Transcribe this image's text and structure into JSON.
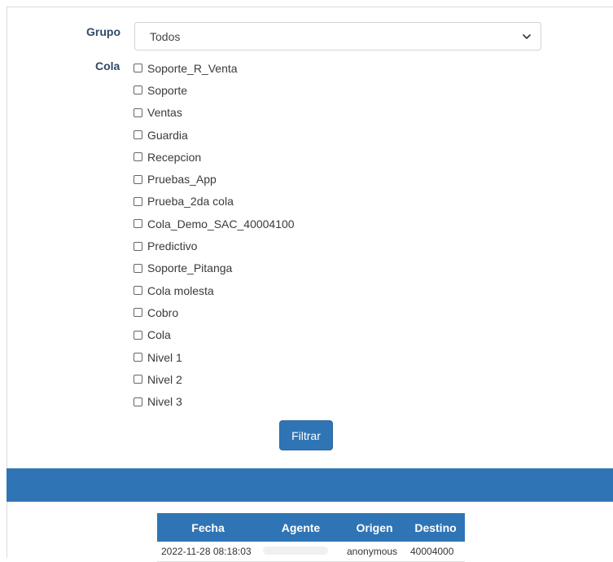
{
  "filters": {
    "grupo_label": "Grupo",
    "grupo_selected": "Todos",
    "cola_label": "Cola",
    "colas": [
      "Soporte_R_Venta",
      "Soporte",
      "Ventas",
      "Guardia",
      "Recepcion",
      "Pruebas_App",
      "Prueba_2da cola",
      "Cola_Demo_SAC_40004100",
      "Predictivo",
      "Soporte_Pitanga",
      "Cola molesta",
      "Cobro",
      "Cola",
      "Nivel 1",
      "Nivel 2",
      "Nivel 3"
    ],
    "filter_button": "Filtrar"
  },
  "table": {
    "headers": [
      "Fecha",
      "Agente",
      "Origen",
      "Destino"
    ],
    "rows": [
      {
        "fecha": "2022-11-28 08:18:03",
        "agente": "",
        "origen": "anonymous",
        "destino": "40004000"
      }
    ]
  },
  "colors": {
    "accent": "#2f75b5",
    "label": "#2f4a68"
  },
  "icons": {
    "select": "chevron-down-icon",
    "checkbox": "checkbox-unchecked-icon"
  }
}
